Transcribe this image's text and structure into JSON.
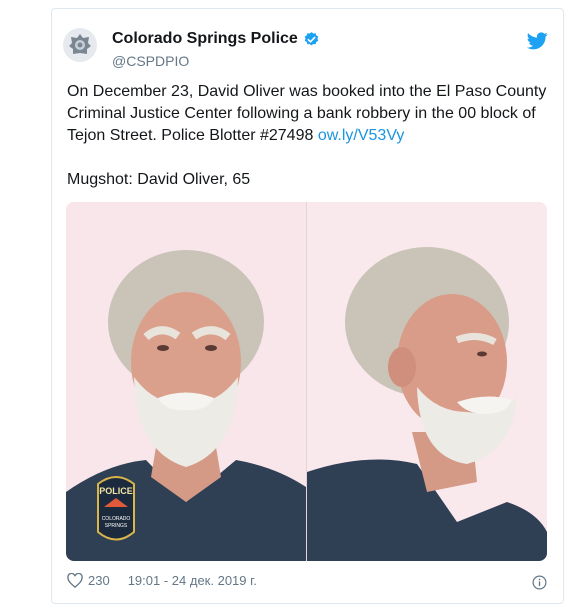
{
  "author": {
    "display_name": "Colorado Springs Police",
    "handle": "@CSPDPIO",
    "verified": true,
    "avatar_icon": "police-badge-icon"
  },
  "tweet": {
    "text_before_link": "On December 23, David Oliver was booked into the El Paso County Criminal Justice Center following a bank robbery in the 00 block of Tejon Street. Police Blotter #27498 ",
    "link": "ow.ly/V53Vy",
    "mugshot_caption": "Mugshot: David Oliver, 65"
  },
  "media": {
    "patch_text_top": "POLICE",
    "patch_text_bottom_1": "COLORADO",
    "patch_text_bottom_2": "SPRINGS"
  },
  "footer": {
    "like_count": "230",
    "timestamp": "19:01 - 24 дек. 2019 г.",
    "like_icon": "heart-icon",
    "info_icon": "info-icon"
  },
  "colors": {
    "brand_blue": "#1da1f2",
    "link_blue": "#1b95e0",
    "muted_gray": "#657786"
  }
}
